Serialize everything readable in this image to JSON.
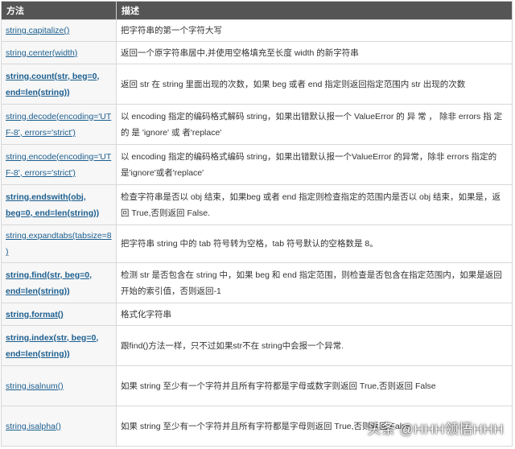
{
  "table": {
    "headers": {
      "method": "方法",
      "description": "描述"
    },
    "rows": [
      {
        "method": "string.capitalize()",
        "bold": false,
        "description": "把字符串的第一个字符大写"
      },
      {
        "method": "string.center(width)",
        "bold": false,
        "description": "返回一个原字符串居中,并使用空格填充至长度 width 的新字符串"
      },
      {
        "method": "string.count(str, beg=0, end=len(string))",
        "bold": true,
        "description": "返回 str 在 string 里面出现的次数，如果 beg 或者 end 指定则返回指定范围内 str 出现的次数"
      },
      {
        "method": "string.decode(encoding='UTF-8', errors='strict')",
        "bold": false,
        "description": "以 encoding 指定的编码格式解码 string，如果出错默认报一个 ValueError 的 异 常 ， 除非 errors 指 定 的 是 'ignore' 或 者'replace'"
      },
      {
        "method": "string.encode(encoding='UTF-8', errors='strict')",
        "bold": false,
        "description": "以 encoding 指定的编码格式编码 string，如果出错默认报一个ValueError 的异常，除非 errors 指定的是'ignore'或者'replace'"
      },
      {
        "method": "string.endswith(obj, beg=0, end=len(string))",
        "bold": true,
        "description": "检查字符串是否以 obj 结束，如果beg 或者 end 指定则检查指定的范围内是否以 obj 结束，如果是，返回 True,否则返回 False."
      },
      {
        "method": "string.expandtabs(tabsize=8)",
        "bold": false,
        "description": "把字符串 string 中的 tab 符号转为空格，tab 符号默认的空格数是 8。"
      },
      {
        "method": "string.find(str, beg=0, end=len(string))",
        "bold": true,
        "description": "检测 str 是否包含在 string 中，如果 beg 和 end 指定范围，则检查是否包含在指定范围内，如果是返回开始的索引值，否则返回-1"
      },
      {
        "method": "string.format()",
        "bold": true,
        "description": "格式化字符串"
      },
      {
        "method": "string.index(str, beg=0, end=len(string))",
        "bold": true,
        "description": "跟find()方法一样，只不过如果str不在 string中会报一个异常."
      },
      {
        "method": "string.isalnum()",
        "bold": false,
        "description": "如果 string 至少有一个字符并且所有字符都是字母或数字则返回 True,否则返回 False"
      },
      {
        "method": "string.isalpha()",
        "bold": false,
        "description": "如果 string 至少有一个字符并且所有字符都是字母则返回 True,否则返回 False"
      }
    ]
  },
  "watermark": {
    "text": "头条 @HHH领悟HHH"
  }
}
